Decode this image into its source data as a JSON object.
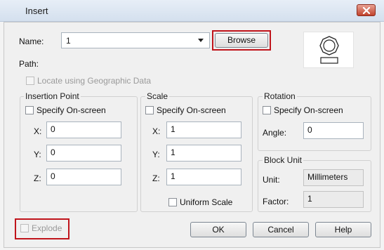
{
  "window": {
    "title": "Insert"
  },
  "name_row": {
    "label": "Name:",
    "value": "1",
    "browse_label": "Browse"
  },
  "path": {
    "label": "Path:"
  },
  "geo": {
    "label": "Locate using Geographic Data"
  },
  "insertion_point": {
    "title": "Insertion Point",
    "specify_label": "Specify On-screen",
    "x_label": "X:",
    "x_value": "0",
    "y_label": "Y:",
    "y_value": "0",
    "z_label": "Z:",
    "z_value": "0"
  },
  "scale": {
    "title": "Scale",
    "specify_label": "Specify On-screen",
    "x_label": "X:",
    "x_value": "1",
    "y_label": "Y:",
    "y_value": "1",
    "z_label": "Z:",
    "z_value": "1",
    "uniform_label": "Uniform Scale"
  },
  "rotation": {
    "title": "Rotation",
    "specify_label": "Specify On-screen",
    "angle_label": "Angle:",
    "angle_value": "0"
  },
  "block_unit": {
    "title": "Block Unit",
    "unit_label": "Unit:",
    "unit_value": "Millimeters",
    "factor_label": "Factor:",
    "factor_value": "1"
  },
  "footer": {
    "explode_label": "Explode",
    "ok_label": "OK",
    "cancel_label": "Cancel",
    "help_label": "Help"
  },
  "colors": {
    "highlight": "#c0141b",
    "close": "#c1432d"
  },
  "icons": {
    "close": "close-icon",
    "preview": "block-preview-icon"
  }
}
